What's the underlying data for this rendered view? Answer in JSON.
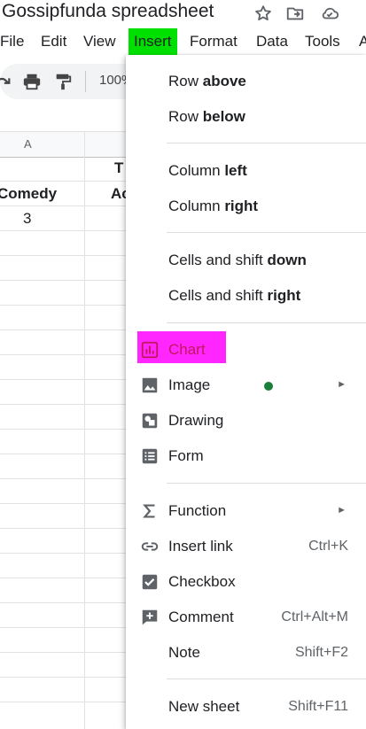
{
  "title_bar": {
    "doc_title": "Gossipfunda spreadsheet",
    "icons": [
      "star-icon",
      "move-to-folder-icon",
      "cloud-status-icon"
    ]
  },
  "menu_bar": {
    "items": [
      "File",
      "Edit",
      "View",
      "Insert",
      "Format",
      "Data",
      "Tools",
      "A"
    ],
    "active": "Insert",
    "active_color": "#00e000"
  },
  "toolbar": {
    "zoom": "100%",
    "icons": [
      "redo-icon",
      "print-icon",
      "paint-format-icon"
    ]
  },
  "sheet": {
    "column_headers": [
      "A"
    ],
    "row1_partial_text": "T",
    "cells": {
      "a2": "Comedy",
      "b2_partial": "Ac",
      "a3": "3"
    }
  },
  "insert_menu": {
    "items": [
      {
        "label_plain": "Row ",
        "label_bold": "above"
      },
      {
        "label_plain": "Row ",
        "label_bold": "below"
      },
      {
        "label_plain": "Column ",
        "label_bold": "left"
      },
      {
        "label_plain": "Column ",
        "label_bold": "right"
      },
      {
        "label_plain": "Cells and shift ",
        "label_bold": "down"
      },
      {
        "label_plain": "Cells and shift ",
        "label_bold": "right"
      }
    ],
    "chart": {
      "label": "Chart",
      "icon": "chart-icon",
      "highlight_color": "#ff00ff"
    },
    "image": {
      "label": "Image",
      "icon": "image-icon",
      "has_submenu": true
    },
    "drawing": {
      "label": "Drawing",
      "icon": "drawing-icon"
    },
    "form": {
      "label": "Form",
      "icon": "form-icon"
    },
    "function": {
      "label": "Function",
      "icon": "sigma-icon",
      "has_submenu": true
    },
    "insert_link": {
      "label": "Insert link",
      "icon": "link-icon",
      "shortcut": "Ctrl+K"
    },
    "checkbox": {
      "label": "Checkbox",
      "icon": "checkbox-icon"
    },
    "comment": {
      "label": "Comment",
      "icon": "comment-icon",
      "shortcut": "Ctrl+Alt+M"
    },
    "note": {
      "label": "Note",
      "shortcut": "Shift+F2"
    },
    "new_sheet": {
      "label": "New sheet",
      "shortcut": "Shift+F11"
    },
    "submenu_arrow": "►"
  }
}
